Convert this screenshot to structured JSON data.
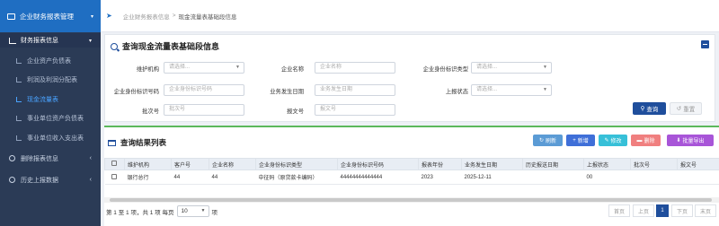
{
  "sidebar": {
    "top_label": "企业财务报表管理",
    "group_label": "财务报表信息",
    "items": [
      {
        "label": "企业资产负债表"
      },
      {
        "label": "利润及利润分配表"
      },
      {
        "label": "现金流量表"
      },
      {
        "label": "事业单位资产负债表"
      },
      {
        "label": "事业单位收入支出表"
      }
    ],
    "extra_groups": [
      {
        "label": "删除报表信息"
      },
      {
        "label": "历史上报数据"
      }
    ]
  },
  "breadcrumb": {
    "parent": "企业财务报表信息",
    "separator": ">",
    "current": "现金流量表基础段信息"
  },
  "query": {
    "title": "查询现金流量表基础段信息",
    "fields": {
      "org_label": "维护机构",
      "org_placeholder": "请选择...",
      "ent_name_label": "企业名称",
      "ent_name_placeholder": "企业名称",
      "id_type_label": "企业身份标识类型",
      "id_type_placeholder": "请选择...",
      "id_code_label": "企业身份标识号码",
      "id_code_placeholder": "企业身份标识号码",
      "biz_date_label": "业务发生日期",
      "biz_date_placeholder": "业务发生日期",
      "status_label": "上报状态",
      "status_placeholder": "请选择...",
      "batch_label": "批次号",
      "batch_placeholder": "批次号",
      "report_no_label": "报文号",
      "report_no_placeholder": "报文号"
    },
    "query_button": "查询",
    "reset_button": "重置"
  },
  "results": {
    "title": "查询结果列表",
    "actions": {
      "refresh": "刷新",
      "add": "新增",
      "edit": "修改",
      "delete": "删除",
      "export": "批量导出"
    },
    "columns": [
      "维护机构",
      "客户号",
      "企业名称",
      "企业身份标识类型",
      "企业身份标识号码",
      "报表年份",
      "业务发生日期",
      "历史报送日期",
      "上报状态",
      "批次号",
      "报文号"
    ],
    "rows": [
      [
        "银行总行",
        "44",
        "44",
        "中征码（原贷款卡编码）",
        "44444444444444",
        "2023",
        "2025-12-11",
        "",
        "00",
        "",
        ""
      ]
    ]
  },
  "pagination": {
    "info_prefix": "第 1 至 1 项，共 1 项  每页",
    "page_size": "10",
    "info_suffix": "项",
    "first": "首页",
    "prev": "上页",
    "current_page": "1",
    "next": "下页",
    "last": "末页"
  },
  "colors": {
    "primary": "#1f4e9c",
    "refresh": "#5b9bd5",
    "add": "#3f6fd8",
    "edit": "#37c0d8",
    "delete": "#f07f7f",
    "export": "#a855d8",
    "sidebar_bg": "#2b3b56",
    "sidebar_top": "#1f6ec2"
  }
}
